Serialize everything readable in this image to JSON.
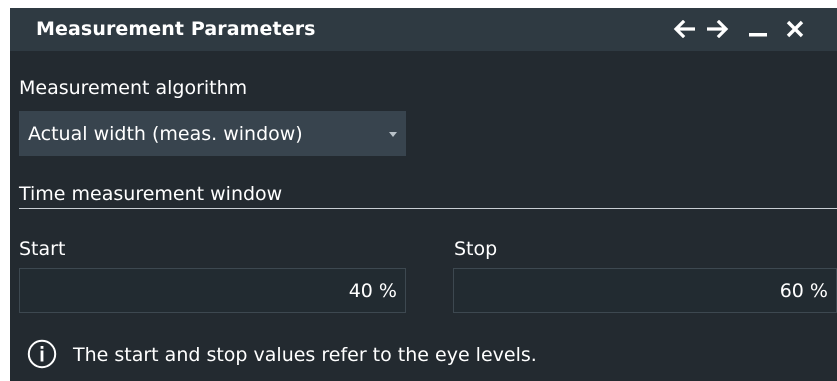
{
  "window": {
    "title": "Measurement Parameters",
    "buttons": {
      "back": "arrow-left-icon",
      "forward": "arrow-right-icon",
      "minimize": "minimize-icon",
      "close": "close-icon"
    }
  },
  "algorithm": {
    "label": "Measurement algorithm",
    "selected": "Actual width (meas. window)"
  },
  "time_window": {
    "section_label": "Time measurement window",
    "start": {
      "label": "Start",
      "value": "40 %"
    },
    "stop": {
      "label": "Stop",
      "value": "60 %"
    }
  },
  "info": {
    "icon": "info-icon",
    "text": "The start and stop values refer to the eye levels."
  },
  "colors": {
    "background": "#232a30",
    "titlebar": "#2f3a42",
    "dropdown": "#38444e",
    "text": "#ffffff"
  }
}
